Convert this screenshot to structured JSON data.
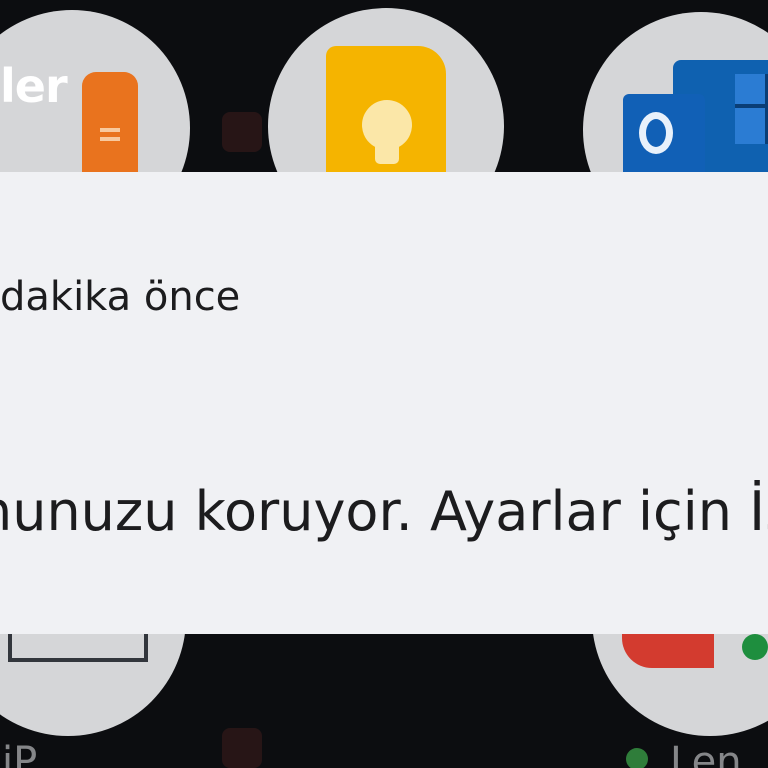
{
  "background": {
    "title_fragment": "ler",
    "bottom_left_label": "  iP",
    "bottom_right_label": "Len"
  },
  "notification": {
    "time": "dakika önce",
    "body": "hunuzu koruyor. Ayarlar için İs"
  },
  "colors": {
    "card_background": "#f0f1f4",
    "text": "#1c1c1e",
    "screen_background": "#0c0d10"
  }
}
